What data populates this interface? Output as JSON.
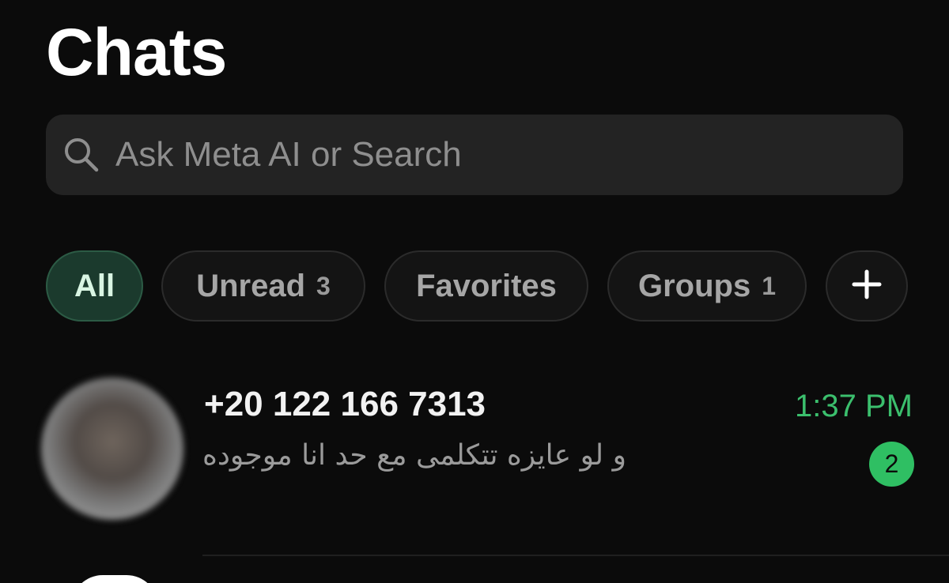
{
  "header": {
    "title": "Chats"
  },
  "search": {
    "placeholder": "Ask Meta AI or Search",
    "icon": "search-icon"
  },
  "filters": [
    {
      "label": "All",
      "count": "",
      "active": true
    },
    {
      "label": "Unread",
      "count": "3",
      "active": false
    },
    {
      "label": "Favorites",
      "count": "",
      "active": false
    },
    {
      "label": "Groups",
      "count": "1",
      "active": false
    }
  ],
  "add_filter_icon": "plus-icon",
  "chats": [
    {
      "name": "+20 122 166 7313",
      "preview": "و لو عايزه تتكلمى مع حد انا موجوده",
      "time": "1:37 PM",
      "unread": "2"
    }
  ],
  "colors": {
    "background": "#0b0b0b",
    "accent": "#3bbf6d",
    "active_chip_bg": "#1b3a2d",
    "search_bg": "#232323"
  }
}
